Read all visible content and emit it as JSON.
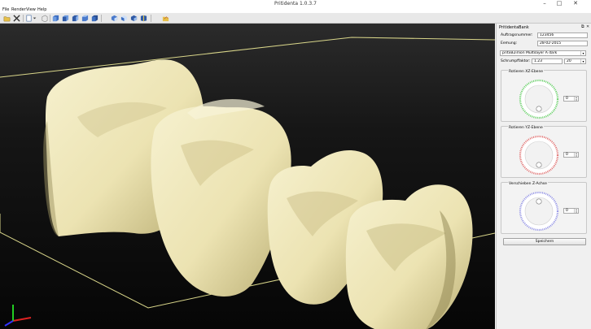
{
  "window": {
    "title": "Pritidenta 1.0.3.7",
    "controls": [
      "–",
      "□",
      "✕"
    ]
  },
  "menu": [
    "File",
    "Render",
    "View",
    "Help"
  ],
  "toolbar": {
    "icons": [
      "open-folder-icon",
      "tools-icon",
      "page-icon",
      "dropdown-arrow-icon",
      "cube-outline-icon",
      "view-front-icon",
      "view-back-icon",
      "view-left-icon",
      "view-right-icon",
      "view-top-icon",
      "view-bottom-icon",
      "view-iso-icon",
      "export-icon",
      "open-icon"
    ]
  },
  "panel": {
    "title": "PritidentaBank",
    "fields": [
      {
        "label": "Auftragsnummer:",
        "value": "123456"
      },
      {
        "label": "Eemung:",
        "value": "28-02-2015"
      }
    ],
    "material_select": "pritxB2irlion Multilayer A dark",
    "shrink": {
      "label": "Schrumpffaktor:",
      "value": "1.23",
      "size": "20"
    },
    "groups": [
      {
        "title": "Rotieren XZ-Ebene",
        "value": "0",
        "color": "#5fcf5f"
      },
      {
        "title": "Rotieren YZ-Ebene",
        "value": "0",
        "color": "#e26a6a"
      },
      {
        "title": "Verschieben Z-Achse",
        "value": "0",
        "color": "#8e8ee6"
      }
    ],
    "save_label": "Speichern"
  },
  "colors": {
    "viewport_top": "#2b2b2b",
    "viewport_bottom": "#060606",
    "grid": "#d9d68a",
    "teeth": "#efe8be"
  }
}
